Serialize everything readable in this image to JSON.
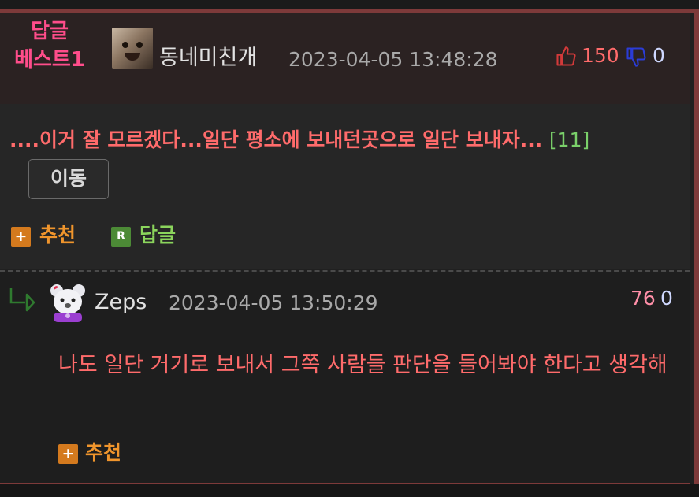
{
  "best_reply": {
    "badge_line1": "답글",
    "badge_line2": "베스트1",
    "nickname": "동네미친개",
    "timestamp": "2023-04-05 13:48:28",
    "upvotes": "150",
    "downvotes": "0",
    "text": "....이거 잘 모르겠다...일단 평소에 보내던곳으로 일단 보내자...",
    "reply_count": "[11]",
    "move_button": "이동",
    "recommend_label": "추천",
    "reply_label": "답글",
    "recommend_icon": "+",
    "reply_icon": "R"
  },
  "sub_reply": {
    "nickname": "Zeps",
    "timestamp": "2023-04-05 13:50:29",
    "upvotes": "76",
    "downvotes": "0",
    "text": "나도 일단 거기로 보내서 그쪽 사람들 판단을 들어봐야 한다고 생각해",
    "recommend_label": "추천",
    "recommend_icon": "+"
  },
  "colors": {
    "frame": "#7d3a3a",
    "badge": "#ff4d8b",
    "text_red": "#ff6b6b",
    "recommend": "#f0952c",
    "reply": "#8bd45c"
  },
  "icons": {
    "thumb_up": "thumb-up-icon",
    "thumb_down": "thumb-down-icon",
    "reply_arrow": "reply-arrow-icon"
  }
}
